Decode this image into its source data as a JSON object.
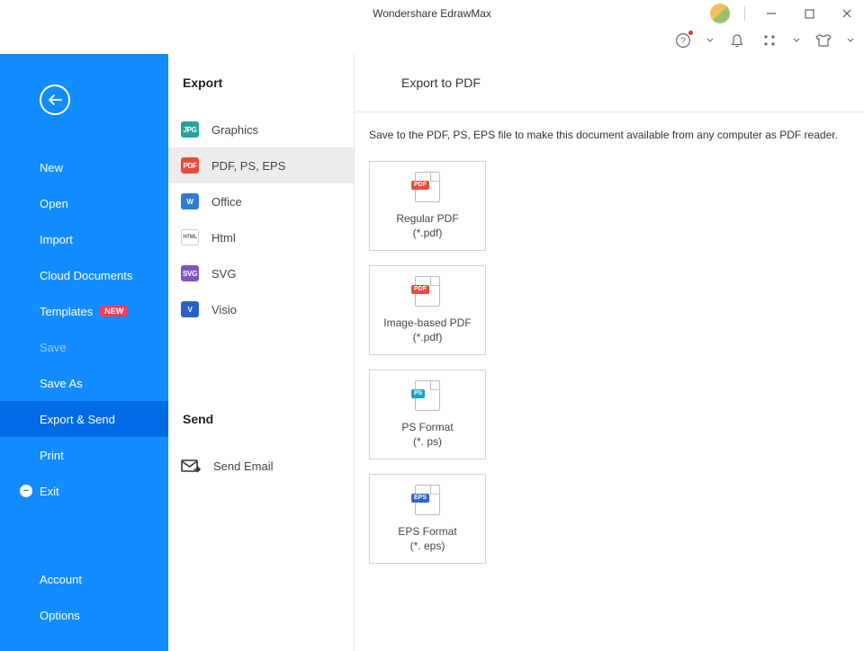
{
  "titlebar": {
    "title": "Wondershare EdrawMax"
  },
  "sidebar": {
    "items": [
      {
        "label": "New"
      },
      {
        "label": "Open"
      },
      {
        "label": "Import"
      },
      {
        "label": "Cloud Documents"
      },
      {
        "label": "Templates",
        "badge": "NEW"
      },
      {
        "label": "Save"
      },
      {
        "label": "Save As"
      },
      {
        "label": "Export & Send"
      },
      {
        "label": "Print"
      },
      {
        "label": "Exit"
      }
    ],
    "bottom": [
      {
        "label": "Account"
      },
      {
        "label": "Options"
      }
    ]
  },
  "export": {
    "heading": "Export",
    "items": [
      {
        "label": "Graphics",
        "badge": "JPG"
      },
      {
        "label": "PDF, PS, EPS",
        "badge": "PDF"
      },
      {
        "label": "Office",
        "badge": "W"
      },
      {
        "label": "Html",
        "badge": "HTML"
      },
      {
        "label": "SVG",
        "badge": "SVG"
      },
      {
        "label": "Visio",
        "badge": "V"
      }
    ]
  },
  "send": {
    "heading": "Send",
    "items": [
      {
        "label": "Send Email"
      }
    ]
  },
  "detail": {
    "title": "Export to PDF",
    "desc": "Save to the PDF, PS, EPS file to make this document available from any computer as PDF reader.",
    "tiles": [
      {
        "name": "Regular PDF",
        "ext": "(*.pdf)",
        "badge": "PDF"
      },
      {
        "name": "Image-based PDF",
        "ext": "(*.pdf)",
        "badge": "PDF"
      },
      {
        "name": "PS Format",
        "ext": "(*. ps)",
        "badge": "PS"
      },
      {
        "name": "EPS Format",
        "ext": "(*. eps)",
        "badge": "EPS"
      }
    ]
  }
}
